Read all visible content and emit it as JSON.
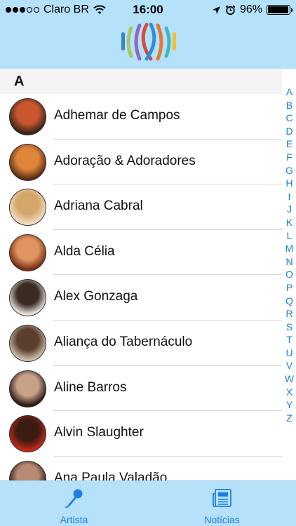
{
  "status_bar": {
    "carrier": "Claro BR",
    "time": "16:00",
    "battery": "96%",
    "battery_level": 0.96,
    "signal_bars": 3,
    "icons": [
      "signal-dots-icon",
      "wifi-icon",
      "location-arrow-icon",
      "alarm-icon",
      "battery-icon"
    ]
  },
  "header": {
    "logo_icon": "app-logo-icon",
    "background": "#b6e1fa"
  },
  "section": {
    "title": "A"
  },
  "artists": [
    {
      "name": "Adhemar de Campos",
      "avatar_colors": [
        "#3b2418",
        "#c9562e"
      ]
    },
    {
      "name": "Adoração & Adoradores",
      "avatar_colors": [
        "#5b2e14",
        "#e0863a"
      ]
    },
    {
      "name": "Adriana Cabral",
      "avatar_colors": [
        "#f2ddc6",
        "#d4a66a"
      ]
    },
    {
      "name": "Alda Célia",
      "avatar_colors": [
        "#7a2c16",
        "#e09560"
      ]
    },
    {
      "name": "Alex Gonzaga",
      "avatar_colors": [
        "#e8e4e0",
        "#3a2a22"
      ]
    },
    {
      "name": "Aliança do Tabernáculo",
      "avatar_colors": [
        "#cdbfae",
        "#5a3e2e"
      ]
    },
    {
      "name": "Aline Barros",
      "avatar_colors": [
        "#2a1a14",
        "#c9a088"
      ]
    },
    {
      "name": "Alvin Slaughter",
      "avatar_colors": [
        "#c0291e",
        "#3a1c12"
      ]
    },
    {
      "name": "Ana Paula Valadão",
      "avatar_colors": [
        "#2b1d1a",
        "#b98a73"
      ]
    }
  ],
  "index_letters": [
    "A",
    "B",
    "C",
    "D",
    "E",
    "F",
    "G",
    "H",
    "I",
    "J",
    "K",
    "L",
    "M",
    "N",
    "O",
    "P",
    "Q",
    "R",
    "S",
    "T",
    "U",
    "V",
    "W",
    "X",
    "Y",
    "Z"
  ],
  "tabbar": {
    "tabs": [
      {
        "label": "Artista",
        "icon": "microphone-icon",
        "selected": true
      },
      {
        "label": "Notícias",
        "icon": "newspaper-icon",
        "selected": false
      }
    ],
    "accent": "#1b7ee6"
  }
}
